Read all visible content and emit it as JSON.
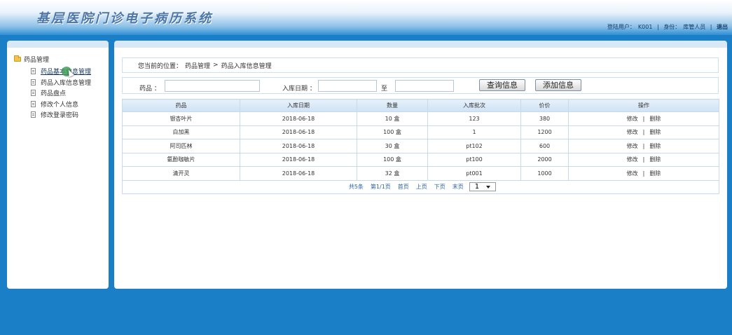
{
  "header": {
    "app_title": "基层医院门诊电子病历系统",
    "user_label": "登陆用户：",
    "user_value": "K001",
    "role_label": "身份：",
    "role_value": "库管人员",
    "separator": "|",
    "logout": "退出"
  },
  "sidebar": {
    "root_label": "药品管理",
    "items": [
      {
        "label": "药品基本信息管理"
      },
      {
        "label": "药品入库信息管理"
      },
      {
        "label": "药品盘点"
      },
      {
        "label": "修改个人信息"
      },
      {
        "label": "修改登录密码"
      }
    ]
  },
  "breadcrumb": {
    "prefix": "您当前的位置：",
    "level1": "药品管理",
    "arrow": ">",
    "level2": "药品入库信息管理"
  },
  "search": {
    "drug_label": "药品 ：",
    "date_label": "入库日期 ：",
    "to_label": "至",
    "drug_value": "",
    "date_from_value": "",
    "date_to_value": "",
    "query_button": "查询信息",
    "add_button": "添加信息"
  },
  "table": {
    "columns": [
      "药品",
      "入库日期",
      "数量",
      "入库批次",
      "价价",
      "操作"
    ],
    "rows": [
      {
        "drug": "银杏叶片",
        "date": "2018-06-18",
        "qty": "10 盒",
        "batch": "123",
        "price": "380"
      },
      {
        "drug": "白加黑",
        "date": "2018-06-18",
        "qty": "100 盒",
        "batch": "1",
        "price": "1200"
      },
      {
        "drug": "阿司匹林",
        "date": "2018-06-18",
        "qty": "30 盒",
        "batch": "pt102",
        "price": "600"
      },
      {
        "drug": "氨酚咖敏片",
        "date": "2018-06-18",
        "qty": "100 盒",
        "batch": "pt100",
        "price": "2000"
      },
      {
        "drug": "清开灵",
        "date": "2018-06-18",
        "qty": "32 盒",
        "batch": "pt001",
        "price": "1000"
      }
    ],
    "edit_label": "修改",
    "op_separator": "|",
    "delete_label": "删除"
  },
  "pager": {
    "total": "共5条",
    "page_info": "第1/1页",
    "first": "首页",
    "prev": "上页",
    "next": "下页",
    "last": "末页",
    "selected_page": "1"
  },
  "colors": {
    "background": "#1a7fc6",
    "title": "#4c76a8",
    "link": "#2a62a8"
  }
}
